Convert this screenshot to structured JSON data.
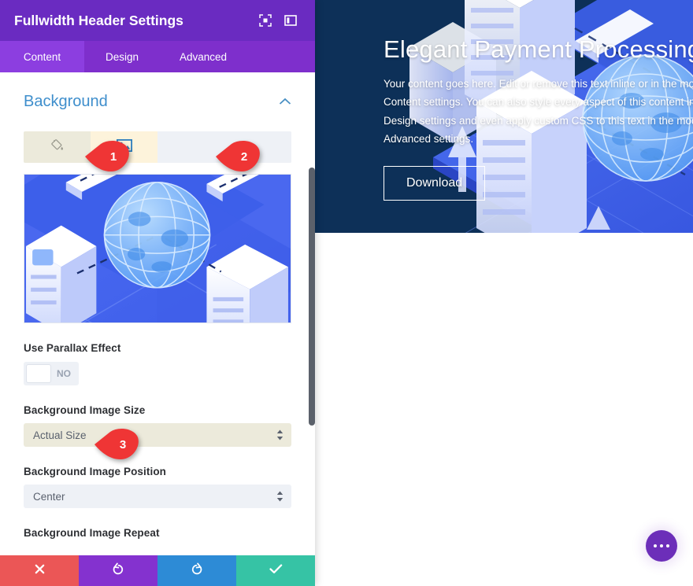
{
  "panel": {
    "title": "Fullwidth Header Settings",
    "header_icons": [
      {
        "name": "fullscreen-icon"
      },
      {
        "name": "panel-layout-icon"
      }
    ],
    "tabs": [
      {
        "label": "Content",
        "active": true
      },
      {
        "label": "Design",
        "active": false
      },
      {
        "label": "Advanced",
        "active": false
      }
    ],
    "section": {
      "title": "Background",
      "collapse_icon": "chevron-up-icon",
      "background_tabs": [
        {
          "name": "background-color-tab",
          "icon": "paint-bucket-icon"
        },
        {
          "name": "background-image-tab",
          "icon": "image-icon"
        },
        {
          "name": "background-video-tab",
          "icon": ""
        },
        {
          "name": "background-pattern-tab",
          "icon": ""
        }
      ],
      "fields": [
        {
          "label": "Use Parallax Effect",
          "type": "toggle",
          "value": "NO"
        },
        {
          "label": "Background Image Size",
          "type": "select",
          "value": "Actual Size",
          "highlighted": true
        },
        {
          "label": "Background Image Position",
          "type": "select",
          "value": "Center",
          "highlighted": false
        },
        {
          "label": "Background Image Repeat",
          "type": "select",
          "value": "",
          "highlighted": false
        }
      ]
    },
    "actions": [
      {
        "name": "cancel-button",
        "icon": "close-icon",
        "color": "#eb5656"
      },
      {
        "name": "undo-button",
        "icon": "undo-icon",
        "color": "#8432cf"
      },
      {
        "name": "redo-button",
        "icon": "redo-icon",
        "color": "#2d8bd6"
      },
      {
        "name": "save-button",
        "icon": "check-icon",
        "color": "#36c3a5"
      }
    ]
  },
  "markers": [
    {
      "label": "1"
    },
    {
      "label": "2"
    },
    {
      "label": "3"
    }
  ],
  "preview": {
    "title": "Elegant Payment Processing",
    "body": "Your content goes here. Edit or remove this text inline or in the module Content settings. You can also style every aspect of this content in the module Design settings and even apply custom CSS to this text in the module Advanced settings.",
    "button_label": "Download",
    "fab": {
      "name": "options-fab",
      "icon": "ellipsis-icon"
    }
  },
  "colors": {
    "panel_header": "#6a2bc1",
    "tabbar": "#7e2fcc",
    "tab_active": "#8c3ee0",
    "section_title": "#3e8ecc",
    "hero_bg": "#0d3058",
    "marker_red": "#ef3535"
  }
}
